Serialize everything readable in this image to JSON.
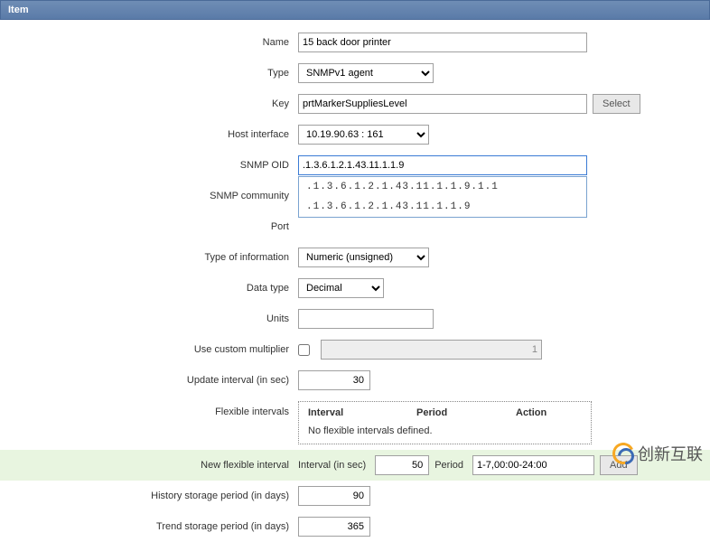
{
  "panel": {
    "title": "Item"
  },
  "labels": {
    "name": "Name",
    "type": "Type",
    "key": "Key",
    "host_interface": "Host interface",
    "snmp_oid": "SNMP OID",
    "snmp_community": "SNMP community",
    "port": "Port",
    "type_of_information": "Type of information",
    "data_type": "Data type",
    "units": "Units",
    "use_custom_multiplier": "Use custom multiplier",
    "update_interval": "Update interval (in sec)",
    "flexible_intervals": "Flexible intervals",
    "new_flexible_interval": "New flexible interval",
    "history_storage": "History storage period (in days)",
    "trend_storage": "Trend storage period (in days)"
  },
  "values": {
    "name": "15 back door printer",
    "type": "SNMPv1 agent",
    "key": "prtMarkerSuppliesLevel",
    "host_interface": "10.19.90.63 : 161",
    "snmp_oid": ".1.3.6.1.2.1.43.11.1.1.9",
    "snmp_community": "",
    "port": "",
    "type_of_information": "Numeric (unsigned)",
    "data_type": "Decimal",
    "units": "",
    "multiplier": "1",
    "update_interval": "30",
    "history_storage": "90",
    "trend_storage": "365"
  },
  "autocomplete": {
    "options": [
      ".1.3.6.1.2.1.43.11.1.1.9.1.1",
      ".1.3.6.1.2.1.43.11.1.1.9"
    ]
  },
  "buttons": {
    "select": "Select",
    "add": "Add"
  },
  "flexible": {
    "col_interval": "Interval",
    "col_period": "Period",
    "col_action": "Action",
    "empty": "No flexible intervals defined."
  },
  "new_flex": {
    "interval_label": "Interval (in sec)",
    "interval_value": "50",
    "period_label": "Period",
    "period_value": "1-7,00:00-24:00"
  },
  "watermark": "创新互联"
}
